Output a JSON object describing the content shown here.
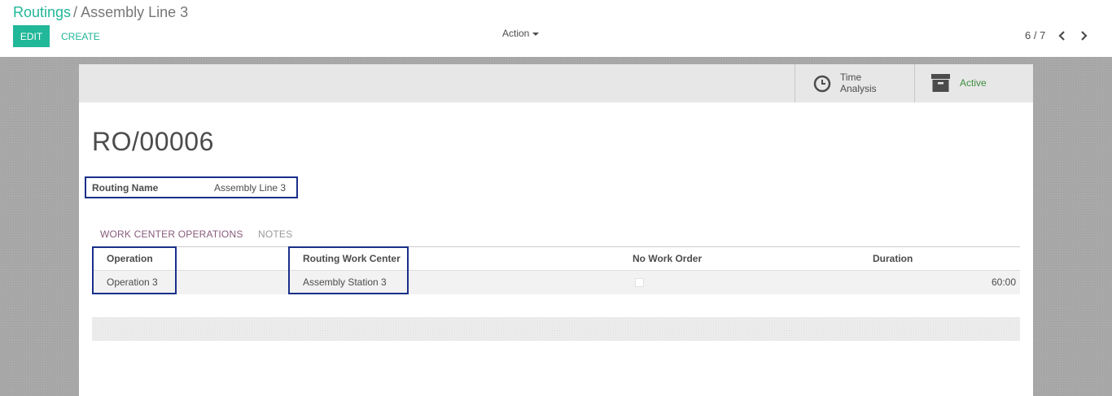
{
  "breadcrumb": {
    "parent": "Routings",
    "separator": "/",
    "current": "Assembly Line 3"
  },
  "toolbar": {
    "edit_label": "EDIT",
    "create_label": "CREATE",
    "action_label": "Action"
  },
  "pager": {
    "value": "6 / 7"
  },
  "stat_buttons": {
    "time_analysis_line1": "Time",
    "time_analysis_line2": "Analysis",
    "active_label": "Active"
  },
  "record": {
    "title": "RO/00006",
    "routing_name_label": "Routing Name",
    "routing_name_value": "Assembly Line 3"
  },
  "tabs": [
    {
      "label": "WORK CENTER OPERATIONS",
      "active": true
    },
    {
      "label": "NOTES",
      "active": false
    }
  ],
  "operations_table": {
    "columns": [
      "Operation",
      "Routing Work Center",
      "No Work Order",
      "Duration"
    ],
    "rows": [
      {
        "operation": "Operation 3",
        "work_center": "Assembly Station 3",
        "no_work_order": false,
        "duration": "60:00"
      }
    ]
  },
  "colors": {
    "brand_teal": "#21b799",
    "tab_active": "#875a7b",
    "active_green": "#3e8d3e",
    "highlight_box": "#1a2f8a"
  },
  "icons": {
    "time_analysis": "clock-icon",
    "active": "archive-icon",
    "pager_prev": "chevron-left-icon",
    "pager_next": "chevron-right-icon",
    "action": "caret-down-icon"
  }
}
